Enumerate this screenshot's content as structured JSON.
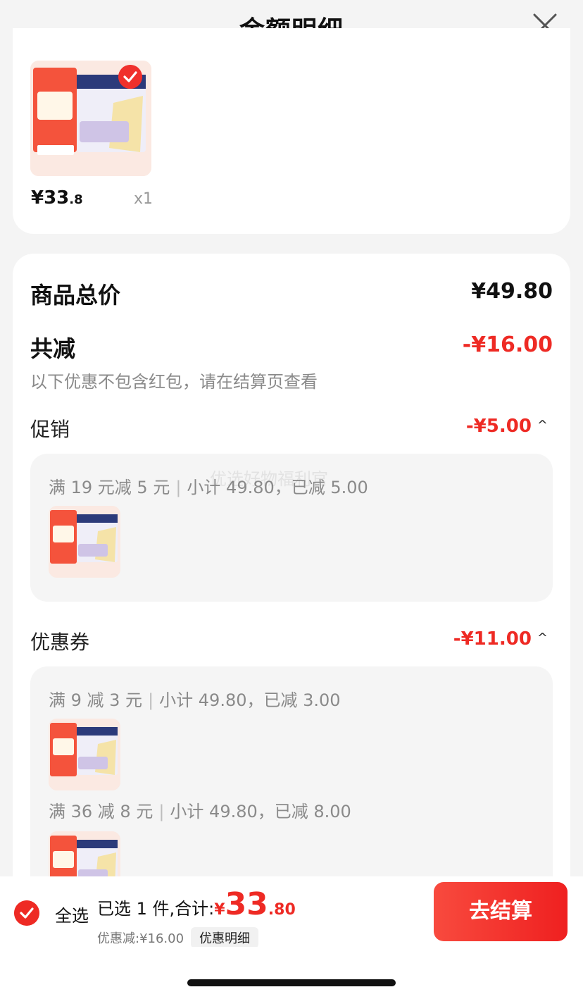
{
  "header": {
    "title": "金额明细"
  },
  "product_card": {
    "price_main": "¥33",
    "price_decimal": ".8",
    "quantity": "x1"
  },
  "summary": {
    "total_label": "商品总价",
    "total_value": "¥49.80",
    "discount_label": "共减",
    "discount_value": "-¥16.00",
    "note": "以下优惠不包含红包，请在结算页查看"
  },
  "promotion": {
    "label": "促销",
    "amount": "-¥5.00",
    "rules": [
      {
        "condition": "满 19 元减 5 元",
        "detail": "小计 49.80，已减 5.00"
      }
    ]
  },
  "coupon": {
    "label": "优惠券",
    "amount": "-¥11.00",
    "rules": [
      {
        "condition": "满 9 减 3 元",
        "detail": "小计 49.80，已减 3.00"
      },
      {
        "condition": "满 36 减 8 元",
        "detail": "小计 49.80，已减 8.00"
      }
    ]
  },
  "bottom_bar": {
    "select_all": "全选",
    "selected_text": "已选 1 件,合计:",
    "currency": "¥",
    "total_int": "33",
    "total_dec": ".80",
    "discount_text": "优惠减:¥16.00",
    "detail_chip": "优惠明细",
    "checkout": "去结算"
  },
  "watermark": "优选好物福利官",
  "colors": {
    "accent": "#ee2a24",
    "background": "#f4f4f4"
  },
  "icons": [
    "close-icon",
    "check-icon"
  ]
}
